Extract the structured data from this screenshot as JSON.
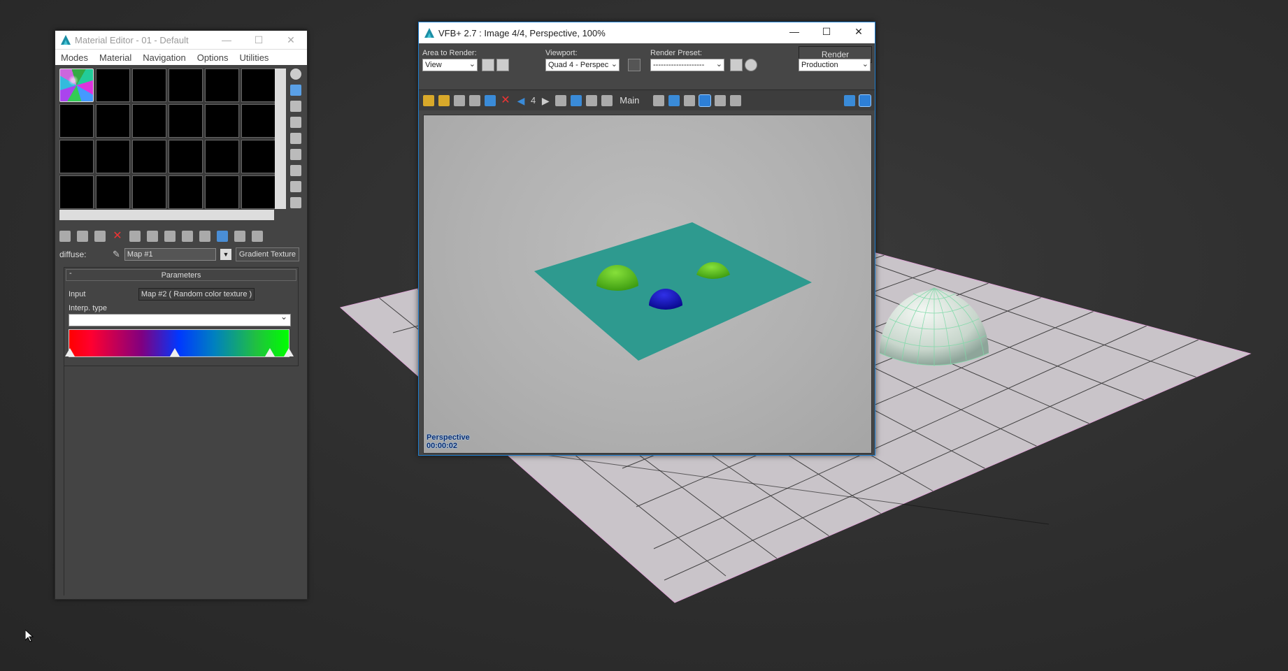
{
  "material_editor": {
    "title": "Material Editor - 01 - Default",
    "menu": [
      "Modes",
      "Material",
      "Navigation",
      "Options",
      "Utilities"
    ],
    "diffuse_label": "diffuse:",
    "map_name": "Map #1",
    "map_type": "Gradient Texture",
    "panel_title": "Parameters",
    "collapse_symbol": "-",
    "input_label": "Input",
    "input_value": "Map #2  ( Random color texture )",
    "interp_label": "Interp. type",
    "interp_value": ""
  },
  "vfb": {
    "title": "VFB+ 2.7 : Image 4/4, Perspective, 100%",
    "area_label": "Area to Render:",
    "area_value": "View",
    "viewport_label": "Viewport:",
    "viewport_value": "Quad 4 - Perspec",
    "preset_label": "Render Preset:",
    "preset_value": "--------------------",
    "render_button": "Render",
    "mode_value": "Production",
    "image_number": "4",
    "channel": "Main",
    "stamp_view": "Perspective",
    "stamp_time": "00:00:02"
  },
  "colors": {
    "accent": "#2d7fd6",
    "plane": "#2e9a8f",
    "green_dome": "#5cc41e",
    "blue_dome": "#1717c8"
  }
}
